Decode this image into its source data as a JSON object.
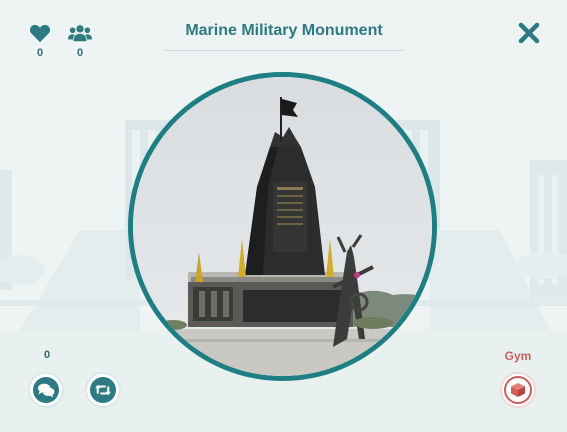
{
  "header": {
    "title": "Marine Military Monument"
  },
  "stats": {
    "likes": "0",
    "followers": "0"
  },
  "comments": {
    "count": "0"
  },
  "gym": {
    "label": "Gym"
  },
  "colors": {
    "accent": "#2d7a82",
    "ring": "#1f7e82",
    "gym": "#c9605b",
    "background": "#eef4f4"
  },
  "icons": {
    "likes": "heart-icon",
    "followers": "users-icon",
    "close": "close-icon",
    "comments": "chat-icon",
    "share": "retweet-icon",
    "gym": "cube-icon"
  }
}
